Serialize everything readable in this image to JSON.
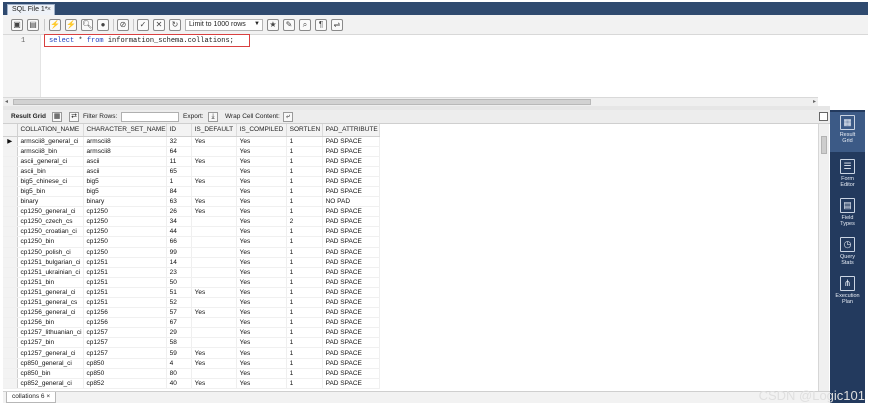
{
  "editor_tab": {
    "label": "SQL File 1*",
    "close": "×"
  },
  "toolbar": {
    "limit_label": "Limit to 1000 rows"
  },
  "editor": {
    "line_number": "1",
    "sql_keyword1": "select",
    "sql_rest1": " * ",
    "sql_keyword2": "from",
    "sql_rest2": " information_schema.collations;"
  },
  "result_toolbar": {
    "result_grid": "Result Grid",
    "filter_rows": "Filter Rows:",
    "export": "Export:",
    "wrap_cell": "Wrap Cell Content:"
  },
  "columns": [
    "COLLATION_NAME",
    "CHARACTER_SET_NAME",
    "ID",
    "IS_DEFAULT",
    "IS_COMPILED",
    "SORTLEN",
    "PAD_ATTRIBUTE"
  ],
  "rows": [
    [
      "armscii8_general_ci",
      "armscii8",
      "32",
      "Yes",
      "Yes",
      "1",
      "PAD SPACE"
    ],
    [
      "armscii8_bin",
      "armscii8",
      "64",
      "",
      "Yes",
      "1",
      "PAD SPACE"
    ],
    [
      "ascii_general_ci",
      "ascii",
      "11",
      "Yes",
      "Yes",
      "1",
      "PAD SPACE"
    ],
    [
      "ascii_bin",
      "ascii",
      "65",
      "",
      "Yes",
      "1",
      "PAD SPACE"
    ],
    [
      "big5_chinese_ci",
      "big5",
      "1",
      "Yes",
      "Yes",
      "1",
      "PAD SPACE"
    ],
    [
      "big5_bin",
      "big5",
      "84",
      "",
      "Yes",
      "1",
      "PAD SPACE"
    ],
    [
      "binary",
      "binary",
      "63",
      "Yes",
      "Yes",
      "1",
      "NO PAD"
    ],
    [
      "cp1250_general_ci",
      "cp1250",
      "26",
      "Yes",
      "Yes",
      "1",
      "PAD SPACE"
    ],
    [
      "cp1250_czech_cs",
      "cp1250",
      "34",
      "",
      "Yes",
      "2",
      "PAD SPACE"
    ],
    [
      "cp1250_croatian_ci",
      "cp1250",
      "44",
      "",
      "Yes",
      "1",
      "PAD SPACE"
    ],
    [
      "cp1250_bin",
      "cp1250",
      "66",
      "",
      "Yes",
      "1",
      "PAD SPACE"
    ],
    [
      "cp1250_polish_ci",
      "cp1250",
      "99",
      "",
      "Yes",
      "1",
      "PAD SPACE"
    ],
    [
      "cp1251_bulgarian_ci",
      "cp1251",
      "14",
      "",
      "Yes",
      "1",
      "PAD SPACE"
    ],
    [
      "cp1251_ukrainian_ci",
      "cp1251",
      "23",
      "",
      "Yes",
      "1",
      "PAD SPACE"
    ],
    [
      "cp1251_bin",
      "cp1251",
      "50",
      "",
      "Yes",
      "1",
      "PAD SPACE"
    ],
    [
      "cp1251_general_ci",
      "cp1251",
      "51",
      "Yes",
      "Yes",
      "1",
      "PAD SPACE"
    ],
    [
      "cp1251_general_cs",
      "cp1251",
      "52",
      "",
      "Yes",
      "1",
      "PAD SPACE"
    ],
    [
      "cp1256_general_ci",
      "cp1256",
      "57",
      "Yes",
      "Yes",
      "1",
      "PAD SPACE"
    ],
    [
      "cp1256_bin",
      "cp1256",
      "67",
      "",
      "Yes",
      "1",
      "PAD SPACE"
    ],
    [
      "cp1257_lithuanian_ci",
      "cp1257",
      "29",
      "",
      "Yes",
      "1",
      "PAD SPACE"
    ],
    [
      "cp1257_bin",
      "cp1257",
      "58",
      "",
      "Yes",
      "1",
      "PAD SPACE"
    ],
    [
      "cp1257_general_ci",
      "cp1257",
      "59",
      "Yes",
      "Yes",
      "1",
      "PAD SPACE"
    ],
    [
      "cp850_general_ci",
      "cp850",
      "4",
      "Yes",
      "Yes",
      "1",
      "PAD SPACE"
    ],
    [
      "cp850_bin",
      "cp850",
      "80",
      "",
      "Yes",
      "1",
      "PAD SPACE"
    ],
    [
      "cp852_general_ci",
      "cp852",
      "40",
      "Yes",
      "Yes",
      "1",
      "PAD SPACE"
    ]
  ],
  "row_marker": "▶",
  "bottom_tab": {
    "label": "collations 6",
    "close": "×"
  },
  "side_panel": [
    {
      "icon": "result-grid-icon",
      "label_1": "Result",
      "label_2": "Grid"
    },
    {
      "icon": "form-editor-icon",
      "label_1": "Form",
      "label_2": "Editor"
    },
    {
      "icon": "field-types-icon",
      "label_1": "Field",
      "label_2": "Types"
    },
    {
      "icon": "query-stats-icon",
      "label_1": "Query",
      "label_2": "Stats"
    },
    {
      "icon": "execution-plan-icon",
      "label_1": "Execution",
      "label_2": "Plan"
    }
  ],
  "watermark": "CSDN @Logic101",
  "colors": {
    "panel": "#233a5e",
    "tabstrip": "#2f4a6f",
    "highlight": "#d94040",
    "keyword": "#1f3fbf"
  }
}
